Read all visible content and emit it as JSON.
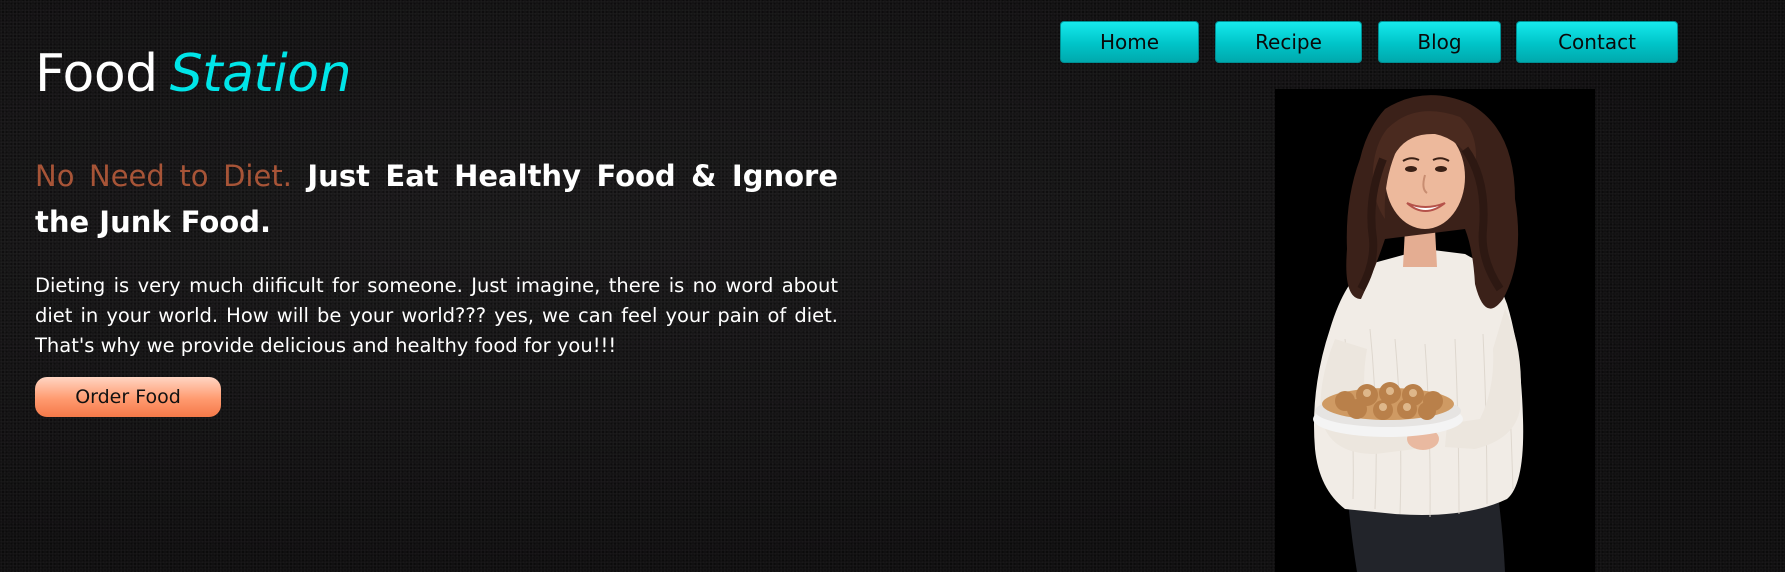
{
  "logo": {
    "word1": "Food",
    "word2": "Station"
  },
  "nav": {
    "items": [
      {
        "label": "Home"
      },
      {
        "label": "Recipe"
      },
      {
        "label": "Blog"
      },
      {
        "label": "Contact"
      }
    ]
  },
  "hero": {
    "headline_accent": "No Need to Diet.",
    "headline_rest": "Just Eat Healthy Food & Ignore the Junk Food.",
    "description": "Dieting is very much diificult for someone. Just imagine, there is no word about diet in your world. How will be your world??? yes, we can feel your pain of diet. That's why we provide delicious and healthy food for you!!!",
    "cta_label": "Order Food"
  },
  "colors": {
    "background": "#131213",
    "accent_cyan": "#00e5e8",
    "accent_rust": "#a75437",
    "cta_orange": "#ff9a6f"
  }
}
